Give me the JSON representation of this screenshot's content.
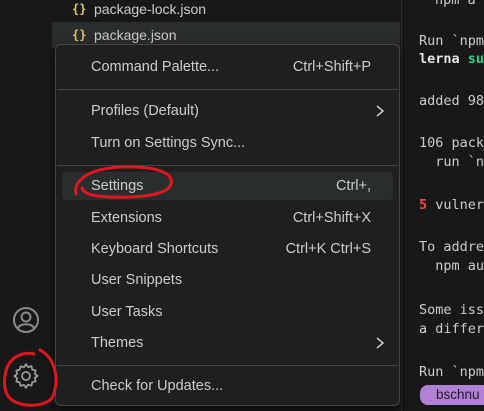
{
  "explorer": {
    "files": [
      {
        "name": "package-lock.json",
        "icon": "json-braces-icon"
      },
      {
        "name": "package.json",
        "icon": "json-braces-icon"
      }
    ],
    "json_glyph": "{}"
  },
  "terminal": {
    "lines": [
      {
        "text": "npm a"
      },
      {
        "text": "Run `npm"
      },
      {
        "pre": "lerna ",
        "accent": "su"
      },
      {
        "text": "added 98"
      },
      {
        "text": "106 pack"
      },
      {
        "text": "  run `n"
      },
      {
        "num": "5",
        "rest": " vulner"
      },
      {
        "text": "To addre"
      },
      {
        "text": "  npm au"
      },
      {
        "text": "Some iss"
      },
      {
        "text": "a differ"
      },
      {
        "text": "Run `npm"
      }
    ],
    "badge": "bschnu"
  },
  "menu": {
    "items": [
      {
        "label": "Command Palette...",
        "shortcut": "Ctrl+Shift+P"
      },
      {
        "label": "Profiles (Default)",
        "submenu": true
      },
      {
        "label": "Turn on Settings Sync..."
      },
      {
        "label": "Settings",
        "shortcut": "Ctrl+,"
      },
      {
        "label": "Extensions",
        "shortcut": "Ctrl+Shift+X"
      },
      {
        "label": "Keyboard Shortcuts",
        "shortcut": "Ctrl+K Ctrl+S"
      },
      {
        "label": "User Snippets"
      },
      {
        "label": "User Tasks"
      },
      {
        "label": "Themes",
        "submenu": true
      },
      {
        "label": "Check for Updates..."
      }
    ]
  },
  "activity_bar": {
    "icons": [
      "account-icon",
      "manage-gear-icon"
    ]
  },
  "colors": {
    "background": "#181818",
    "menu_bg": "#1f1f1f",
    "text": "#cccccc",
    "annotation": "#e0161c",
    "json_icon": "#e3c363",
    "terminal_green": "#23d18b",
    "terminal_red": "#f14c4c",
    "badge": "#b180d7"
  }
}
